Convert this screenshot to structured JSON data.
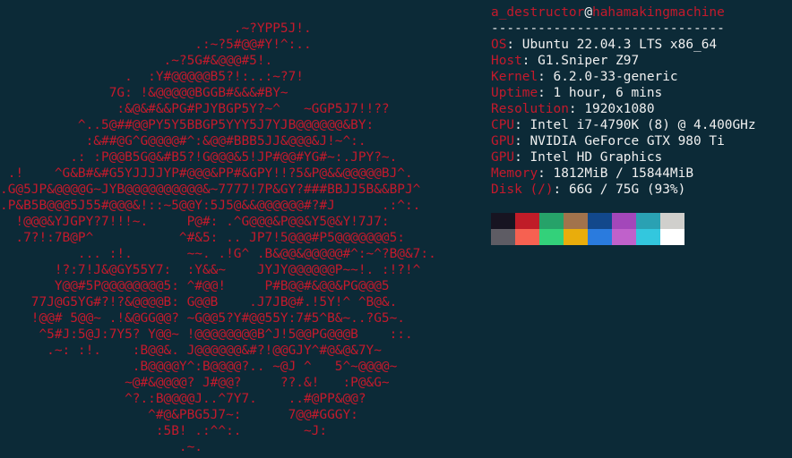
{
  "colors": {
    "background": "#0c2a37",
    "accent": "#c41a2c",
    "text": "#f0f0f0"
  },
  "logo": {
    "color": "#c41a2c",
    "lines": [
      "                              .~?YPP5J!.",
      "                         .:~?5#@@#Y!^:..",
      "                     .~?5G#&@@@#5!.",
      "                .  :Y#@@@@@B5?!:..:~?7!",
      "              7G: !&@@@@@BGGB#&&&#BY~",
      "               :&@&#&&PG#PJYBGP5Y?~^   ~GGP5J7!!??",
      "          ^..5@##@@PY5Y5BBGP5YYY5J7YJB@@@@@@&BY:",
      "           :&##@G^G@@@@#^:&@@#BBB5JJ&@@@&J!~^:.",
      "         .: :P@@B5G@&#B5?!G@@@&5!JP#@@#YG#~:.JPY?~.",
      " .!    ^G&B#&#G5YJJJJYP#@@@&PP#&GPY!!?5&P@&&@@@@@BJ^.",
      ".G@5JP&@@@@G~JYB@@@@@@@@@@&~7777!7P&GY?###BBJJ5B&&BPJ^",
      ".P&B5B@@@5J55#@@@&!::~5@@Y:5J5@&&@@@@@@#?#J      .:^:.",
      "  !@@@&YJGPY?7!!!~.     P@#: .^G@@@&P@@&Y5@&Y!7J7:",
      "  .7?!:7B@P^           ^#&5: .. JP7!5@@@#P5@@@@@@@5:",
      "          ... :!.       ~~. .!G^ .B&@@&@@@@@#^:~^?B@&7:.",
      "       !?:7!J&@GY55Y7:  :Y&&~    JYJY@@@@@@P~~!. :!?!^",
      "       Y@@#5P@@@@@@@@5: ^#@@!     P#B@@#&@@&PG@@@5",
      "    77J@G5YG#?!?&@@@@B: G@@B    .J7JB@#.!5Y!^ ^B@&.",
      "    !@@# 5@@~ .!&@GG@@? ~G@@5?Y#@@55Y:7#5^B&~..?G5~.",
      "     ^5#J:5@J:7Y5? Y@@~ !@@@@@@@@B^J!5@@PG@@@B    ::.",
      "      .~: :!.    :B@@&. J@@@@@@&#?!@@GJY^#@&@&7Y~",
      "                 .B@@@@Y^:B@@@@?.. ~@J ^   5^~@@@@~",
      "                ~@#&@@@@? J#@@?     ??.&!   :P@&G~",
      "                ^?.:B@@@@J..^7Y7.    ..#@PP&@@?",
      "                   ^#@&PBG5J7~:      7@@#GGGY:",
      "                    :5B! .:^^:.        ~J:",
      "                       .~."
    ]
  },
  "info": {
    "user": "a_destructor",
    "at": "@",
    "host": "hahamakingmachine",
    "separator": "------------------------------",
    "rows": [
      {
        "key": "OS",
        "value": "Ubuntu 22.04.3 LTS x86_64"
      },
      {
        "key": "Host",
        "value": "G1.Sniper Z97"
      },
      {
        "key": "Kernel",
        "value": "6.2.0-33-generic"
      },
      {
        "key": "Uptime",
        "value": "1 hour, 6 mins"
      },
      {
        "key": "Resolution",
        "value": "1920x1080"
      },
      {
        "key": "CPU",
        "value": "Intel i7-4790K (8) @ 4.400GHz"
      },
      {
        "key": "GPU",
        "value": "NVIDIA GeForce GTX 980 Ti"
      },
      {
        "key": "GPU",
        "value": "Intel HD Graphics"
      },
      {
        "key": "Memory",
        "value": "1812MiB / 15844MiB"
      },
      {
        "key": "Disk (/)",
        "value": "66G / 75G (93%)"
      }
    ],
    "key_suffix": ": "
  },
  "palette": {
    "row1": [
      "#171421",
      "#c01c28",
      "#26a269",
      "#a2734c",
      "#12488b",
      "#a347ba",
      "#2aa1b3",
      "#d0cfcc"
    ],
    "row2": [
      "#5e5c64",
      "#f66151",
      "#33d17a",
      "#e9ad0c",
      "#2a7bde",
      "#c061cb",
      "#33c7de",
      "#ffffff"
    ]
  }
}
